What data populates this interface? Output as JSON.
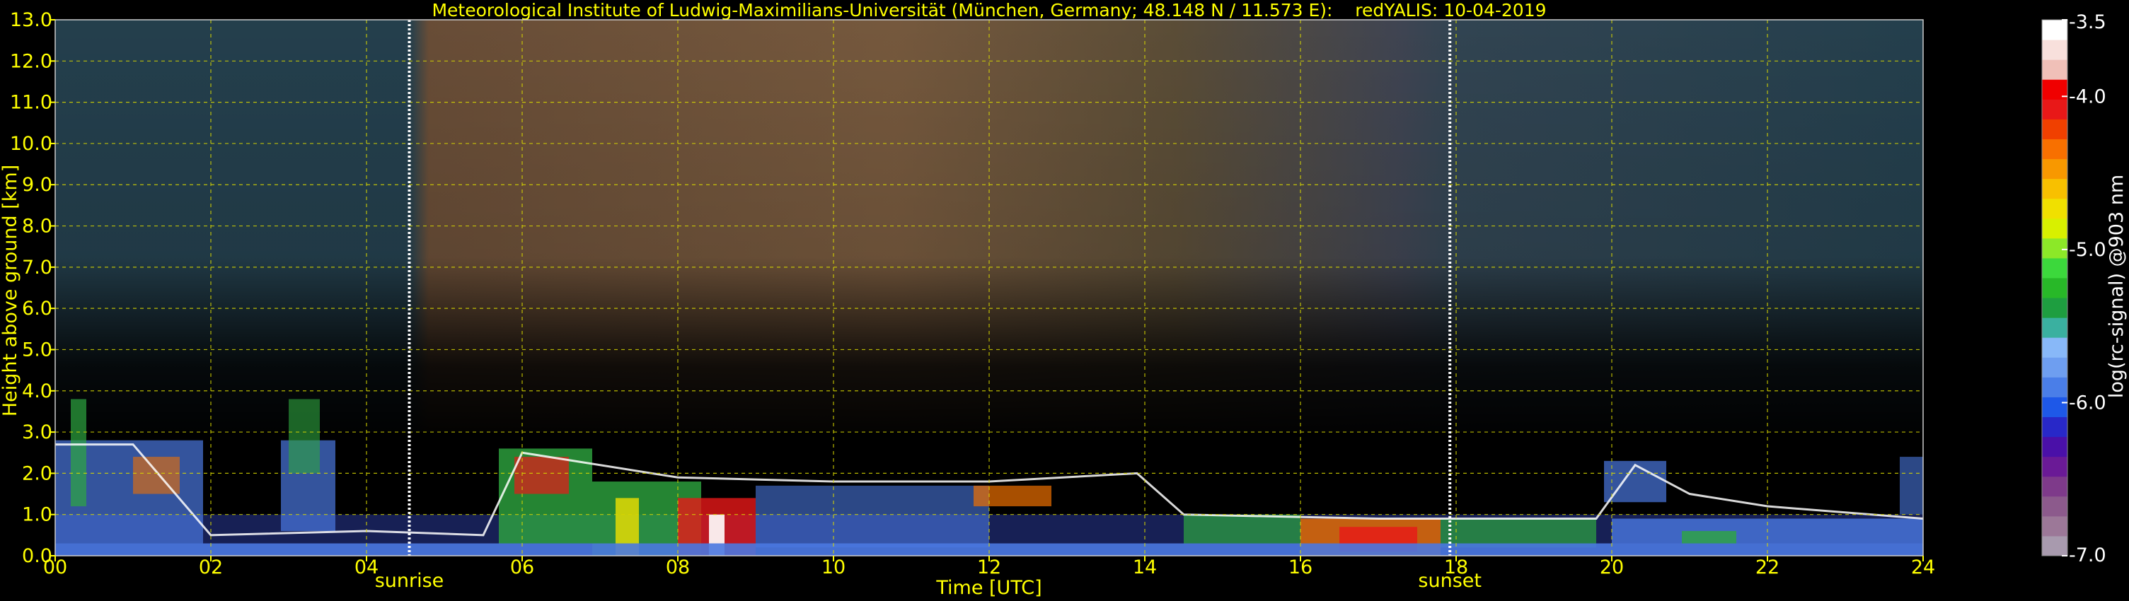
{
  "chart_data": {
    "type": "heatmap",
    "title": "Meteorological Institute of Ludwig-Maximilians-Universität (München, Germany; 48.148 N / 11.573 E):    redYALIS: 10-04-2019",
    "xlabel": "Time [UTC]",
    "ylabel": "Height above ground [km]",
    "xlim": [
      0,
      24
    ],
    "ylim": [
      0,
      13
    ],
    "x_ticks": [
      {
        "value": 0,
        "label": "00"
      },
      {
        "value": 2,
        "label": "02"
      },
      {
        "value": 4,
        "label": "04"
      },
      {
        "value": 6,
        "label": "06"
      },
      {
        "value": 8,
        "label": "08"
      },
      {
        "value": 10,
        "label": "10"
      },
      {
        "value": 12,
        "label": "12"
      },
      {
        "value": 14,
        "label": "14"
      },
      {
        "value": 16,
        "label": "16"
      },
      {
        "value": 18,
        "label": "18"
      },
      {
        "value": 20,
        "label": "20"
      },
      {
        "value": 22,
        "label": "22"
      },
      {
        "value": 24,
        "label": "24"
      }
    ],
    "y_ticks": [
      {
        "value": 0,
        "label": "0.0"
      },
      {
        "value": 1,
        "label": "1.0"
      },
      {
        "value": 2,
        "label": "2.0"
      },
      {
        "value": 3,
        "label": "3.0"
      },
      {
        "value": 4,
        "label": "4.0"
      },
      {
        "value": 5,
        "label": "5.0"
      },
      {
        "value": 6,
        "label": "6.0"
      },
      {
        "value": 7,
        "label": "7.0"
      },
      {
        "value": 8,
        "label": "8.0"
      },
      {
        "value": 9,
        "label": "9.0"
      },
      {
        "value": 10,
        "label": "10.0"
      },
      {
        "value": 11,
        "label": "11.0"
      },
      {
        "value": 12,
        "label": "12.0"
      },
      {
        "value": 13,
        "label": "13.0"
      }
    ],
    "grid": true,
    "markers": [
      {
        "name": "sunrise",
        "x": 4.55,
        "label": "sunrise"
      },
      {
        "name": "sunset",
        "x": 17.92,
        "label": "sunset"
      }
    ],
    "colorbar": {
      "label": "log(rc-signal) @903 nm",
      "range": [
        -7.0,
        -3.5
      ],
      "ticks": [
        {
          "value": -3.5,
          "label": "-3.5"
        },
        {
          "value": -4.0,
          "label": "-4.0"
        },
        {
          "value": -5.0,
          "label": "-5.0"
        },
        {
          "value": -6.0,
          "label": "-6.0"
        },
        {
          "value": -7.0,
          "label": "-7.0"
        }
      ],
      "colors": [
        "#a89aae",
        "#9c7898",
        "#8c5a8c",
        "#7e3a8a",
        "#6a1a96",
        "#4a10a8",
        "#2828c8",
        "#1e58e8",
        "#4a7ee8",
        "#6e9ef0",
        "#88b8f8",
        "#3ab0a0",
        "#1e9e40",
        "#28b828",
        "#3cd83c",
        "#8ce828",
        "#d8f000",
        "#f0e000",
        "#f8c000",
        "#f89800",
        "#f87000",
        "#f04000",
        "#e81818",
        "#f00000",
        "#f0c0b8",
        "#f8e0dc",
        "#ffffff"
      ],
      "layer_colors": [
        "#4a78e0",
        "#2ea640",
        "#f0e000",
        "#f07000",
        "#e81818",
        "#ffffff"
      ]
    }
  }
}
